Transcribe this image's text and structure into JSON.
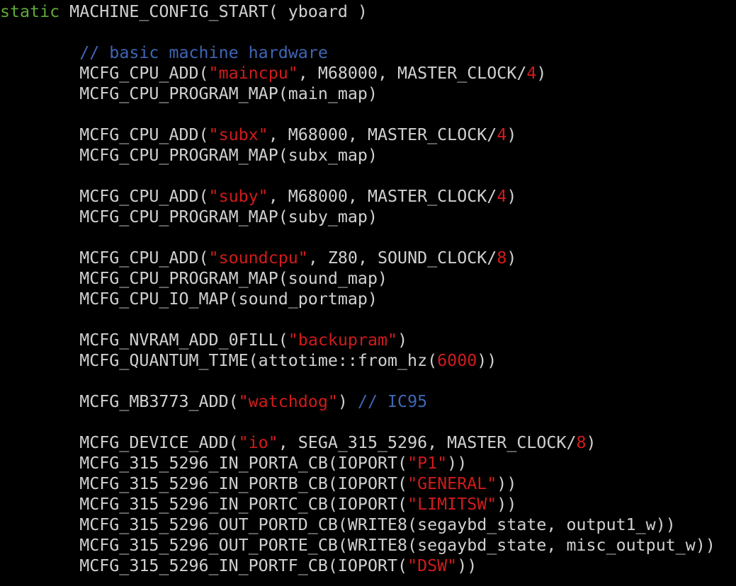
{
  "lines": [
    [
      {
        "t": "kw",
        "v": "static"
      },
      {
        "t": "pl",
        "v": " MACHINE_CONFIG_START( yboard )"
      }
    ],
    [],
    [
      {
        "t": "pl",
        "v": "        "
      },
      {
        "t": "cm",
        "v": "// basic machine hardware"
      }
    ],
    [
      {
        "t": "pl",
        "v": "        MCFG_CPU_ADD("
      },
      {
        "t": "str",
        "v": "\"maincpu\""
      },
      {
        "t": "pl",
        "v": ", M68000, MASTER_CLOCK/"
      },
      {
        "t": "num",
        "v": "4"
      },
      {
        "t": "pl",
        "v": ")"
      }
    ],
    [
      {
        "t": "pl",
        "v": "        MCFG_CPU_PROGRAM_MAP(main_map)"
      }
    ],
    [],
    [
      {
        "t": "pl",
        "v": "        MCFG_CPU_ADD("
      },
      {
        "t": "str",
        "v": "\"subx\""
      },
      {
        "t": "pl",
        "v": ", M68000, MASTER_CLOCK/"
      },
      {
        "t": "num",
        "v": "4"
      },
      {
        "t": "pl",
        "v": ")"
      }
    ],
    [
      {
        "t": "pl",
        "v": "        MCFG_CPU_PROGRAM_MAP(subx_map)"
      }
    ],
    [],
    [
      {
        "t": "pl",
        "v": "        MCFG_CPU_ADD("
      },
      {
        "t": "str",
        "v": "\"suby\""
      },
      {
        "t": "pl",
        "v": ", M68000, MASTER_CLOCK/"
      },
      {
        "t": "num",
        "v": "4"
      },
      {
        "t": "pl",
        "v": ")"
      }
    ],
    [
      {
        "t": "pl",
        "v": "        MCFG_CPU_PROGRAM_MAP(suby_map)"
      }
    ],
    [],
    [
      {
        "t": "pl",
        "v": "        MCFG_CPU_ADD("
      },
      {
        "t": "str",
        "v": "\"soundcpu\""
      },
      {
        "t": "pl",
        "v": ", Z80, SOUND_CLOCK/"
      },
      {
        "t": "num",
        "v": "8"
      },
      {
        "t": "pl",
        "v": ")"
      }
    ],
    [
      {
        "t": "pl",
        "v": "        MCFG_CPU_PROGRAM_MAP(sound_map)"
      }
    ],
    [
      {
        "t": "pl",
        "v": "        MCFG_CPU_IO_MAP(sound_portmap)"
      }
    ],
    [],
    [
      {
        "t": "pl",
        "v": "        MCFG_NVRAM_ADD_0FILL("
      },
      {
        "t": "str",
        "v": "\"backupram\""
      },
      {
        "t": "pl",
        "v": ")"
      }
    ],
    [
      {
        "t": "pl",
        "v": "        MCFG_QUANTUM_TIME(attotime::from_hz("
      },
      {
        "t": "num",
        "v": "6000"
      },
      {
        "t": "pl",
        "v": "))"
      }
    ],
    [],
    [
      {
        "t": "pl",
        "v": "        MCFG_MB3773_ADD("
      },
      {
        "t": "str",
        "v": "\"watchdog\""
      },
      {
        "t": "pl",
        "v": ") "
      },
      {
        "t": "cm",
        "v": "// IC95"
      }
    ],
    [],
    [
      {
        "t": "pl",
        "v": "        MCFG_DEVICE_ADD("
      },
      {
        "t": "str",
        "v": "\"io\""
      },
      {
        "t": "pl",
        "v": ", SEGA_315_5296, MASTER_CLOCK/"
      },
      {
        "t": "num",
        "v": "8"
      },
      {
        "t": "pl",
        "v": ")"
      }
    ],
    [
      {
        "t": "pl",
        "v": "        MCFG_315_5296_IN_PORTA_CB(IOPORT("
      },
      {
        "t": "str",
        "v": "\"P1\""
      },
      {
        "t": "pl",
        "v": "))"
      }
    ],
    [
      {
        "t": "pl",
        "v": "        MCFG_315_5296_IN_PORTB_CB(IOPORT("
      },
      {
        "t": "str",
        "v": "\"GENERAL\""
      },
      {
        "t": "pl",
        "v": "))"
      }
    ],
    [
      {
        "t": "pl",
        "v": "        MCFG_315_5296_IN_PORTC_CB(IOPORT("
      },
      {
        "t": "str",
        "v": "\"LIMITSW\""
      },
      {
        "t": "pl",
        "v": "))"
      }
    ],
    [
      {
        "t": "pl",
        "v": "        MCFG_315_5296_OUT_PORTD_CB(WRITE8(segaybd_state, output1_w))"
      }
    ],
    [
      {
        "t": "pl",
        "v": "        MCFG_315_5296_OUT_PORTE_CB(WRITE8(segaybd_state, misc_output_w))"
      }
    ],
    [
      {
        "t": "pl",
        "v": "        MCFG_315_5296_IN_PORTF_CB(IOPORT("
      },
      {
        "t": "str",
        "v": "\"DSW\""
      },
      {
        "t": "pl",
        "v": "))"
      }
    ]
  ],
  "colors": {
    "background": "#000000",
    "plain": "#d0d0d0",
    "keyword": "#5fa93a",
    "string": "#d01b1b",
    "number": "#d01b1b",
    "comment": "#3f66b5"
  }
}
